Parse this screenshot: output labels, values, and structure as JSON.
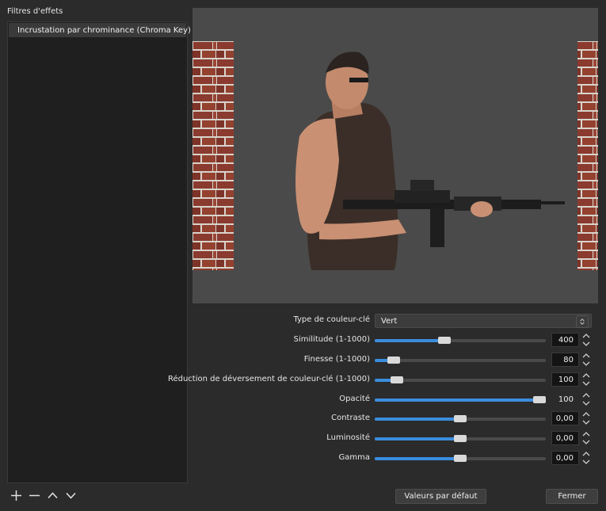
{
  "left_panel": {
    "title": "Filtres d'effets",
    "filters": [
      {
        "label": "Incrustation par chrominance (Chroma Key)",
        "visible": true
      }
    ],
    "tools": [
      "add-icon",
      "remove-icon",
      "move-up-icon",
      "move-down-icon"
    ]
  },
  "properties": {
    "key_color_type": {
      "label": "Type de couleur-clé",
      "value": "Vert"
    },
    "similarity": {
      "label": "Similitude (1-1000)",
      "value": "400",
      "level": 0.4
    },
    "smoothness": {
      "label": "Finesse (1-1000)",
      "value": "80",
      "level": 0.08
    },
    "spill": {
      "label": "Réduction de déversement de couleur-clé (1-1000)",
      "value": "100",
      "level": 0.1
    },
    "opacity": {
      "label": "Opacité",
      "value": "100",
      "level": 1.0
    },
    "contrast": {
      "label": "Contraste",
      "value": "0,00",
      "level": 0.5
    },
    "brightness": {
      "label": "Luminosité",
      "value": "0,00",
      "level": 0.5
    },
    "gamma": {
      "label": "Gamma",
      "value": "0,00",
      "level": 0.5
    }
  },
  "buttons": {
    "defaults": "Valeurs par défaut",
    "close": "Fermer"
  },
  "colors": {
    "accent": "#3b8ddd",
    "background": "#2b2b2b",
    "preview_bg": "#4a4a4a"
  }
}
